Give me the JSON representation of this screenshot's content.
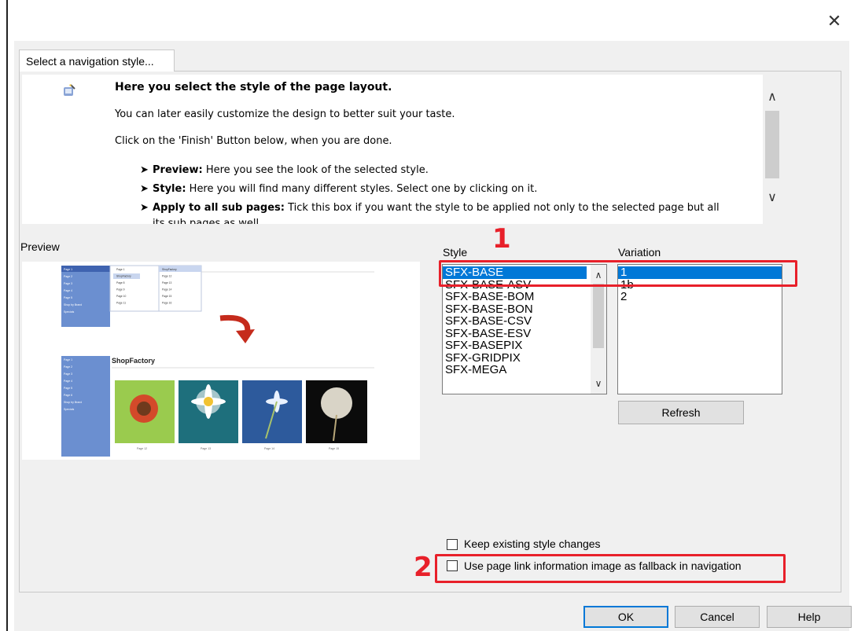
{
  "window": {
    "close_icon": "close-icon"
  },
  "tab": {
    "label": "Select a navigation style..."
  },
  "info": {
    "headline": "Here you select the style of the page layout.",
    "line2": "You can later easily customize the design to better suit your taste.",
    "line3": "Click on the 'Finish' Button below, when you are done.",
    "bullets": [
      {
        "term": "Preview:",
        "text": " Here you see the look of the selected style."
      },
      {
        "term": "Style:",
        "text": " Here you will find many different styles. Select one by clicking on it."
      },
      {
        "term": "Apply to all sub pages:",
        "text": " Tick this box if you want the style to be applied not only to the selected page but all"
      }
    ],
    "cut_line": "its sub pages as well"
  },
  "preview": {
    "label": "Preview",
    "shop_title": "ShopFactory",
    "menu_top": [
      "Page 1",
      "Page 2",
      "Page 3",
      "Page 4",
      "Page 5",
      "Shop by Brand",
      "Specials"
    ],
    "menu_bottom": [
      "Page 1",
      "Page 2",
      "Page 3",
      "Page 4",
      "Page 5",
      "Page 6",
      "Shop by Brand",
      "Specials"
    ],
    "submenu1": [
      "Page 1",
      "ShopFactory",
      "Page 8",
      "Page 9",
      "Page 10",
      "Page 11"
    ],
    "submenu2": [
      "ShopFactory",
      "Page 12",
      "Page 13",
      "Page 14",
      "Page 15",
      "Page 16"
    ],
    "thumb_captions": [
      "Page 12",
      "Page 13",
      "Page 14",
      "Page 15"
    ]
  },
  "style": {
    "label": "Style",
    "items": [
      "SFX-BASE",
      "SFX-BASE-ASV",
      "SFX-BASE-BOM",
      "SFX-BASE-BON",
      "SFX-BASE-CSV",
      "SFX-BASE-ESV",
      "SFX-BASEPIX",
      "SFX-GRIDPIX",
      "SFX-MEGA"
    ],
    "selected": "SFX-BASE"
  },
  "variation": {
    "label": "Variation",
    "items": [
      "1",
      "1b",
      "2"
    ],
    "selected": "1"
  },
  "buttons": {
    "refresh": "Refresh",
    "ok": "OK",
    "cancel": "Cancel",
    "help": "Help"
  },
  "options": {
    "keep_existing": {
      "label": "Keep existing style changes",
      "checked": false
    },
    "use_page_link": {
      "label": "Use page link information image as fallback in navigation",
      "checked": false
    }
  },
  "annotations": {
    "marker1": "1",
    "marker2": "2",
    "color": "#e8202a"
  },
  "colors": {
    "selection": "#0078d7",
    "dialog_bg": "#f0f0f0",
    "menu_blue": "#6b8fd0"
  }
}
